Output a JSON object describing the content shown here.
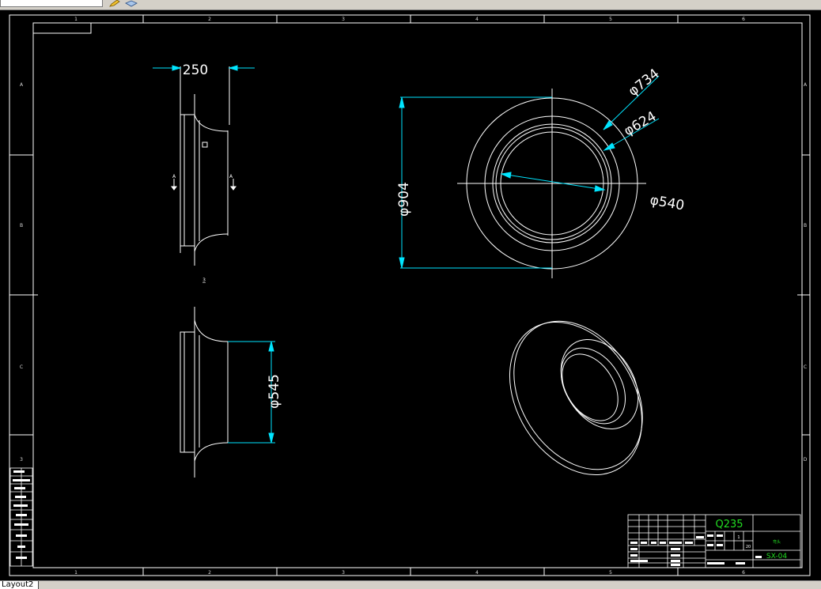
{
  "tabs": {
    "layout_tab": "Layout2"
  },
  "border": {
    "columns": [
      "1",
      "2",
      "3",
      "4",
      "5",
      "6"
    ],
    "rows_left": [
      "A",
      "B",
      "C",
      "3"
    ],
    "rows_right": [
      "A",
      "B",
      "C",
      "D"
    ]
  },
  "side_view": {
    "dim_width": "250",
    "section_left": "A",
    "section_right": "A",
    "view_label": "3"
  },
  "section_view": {
    "dim_diameter": "φ545"
  },
  "front_view": {
    "dim_outer": "φ904",
    "dim_734": "φ734",
    "dim_624": "φ624",
    "dim_540": "φ540"
  },
  "title_block": {
    "material": "Q235",
    "drawing_no": "SX-04",
    "name": "弯头",
    "qty": "1",
    "scale": "20"
  },
  "colors": {
    "line": "#ffffff",
    "dimension": "#00e5ff",
    "accent_text": "#22dd22",
    "background": "#000000"
  }
}
